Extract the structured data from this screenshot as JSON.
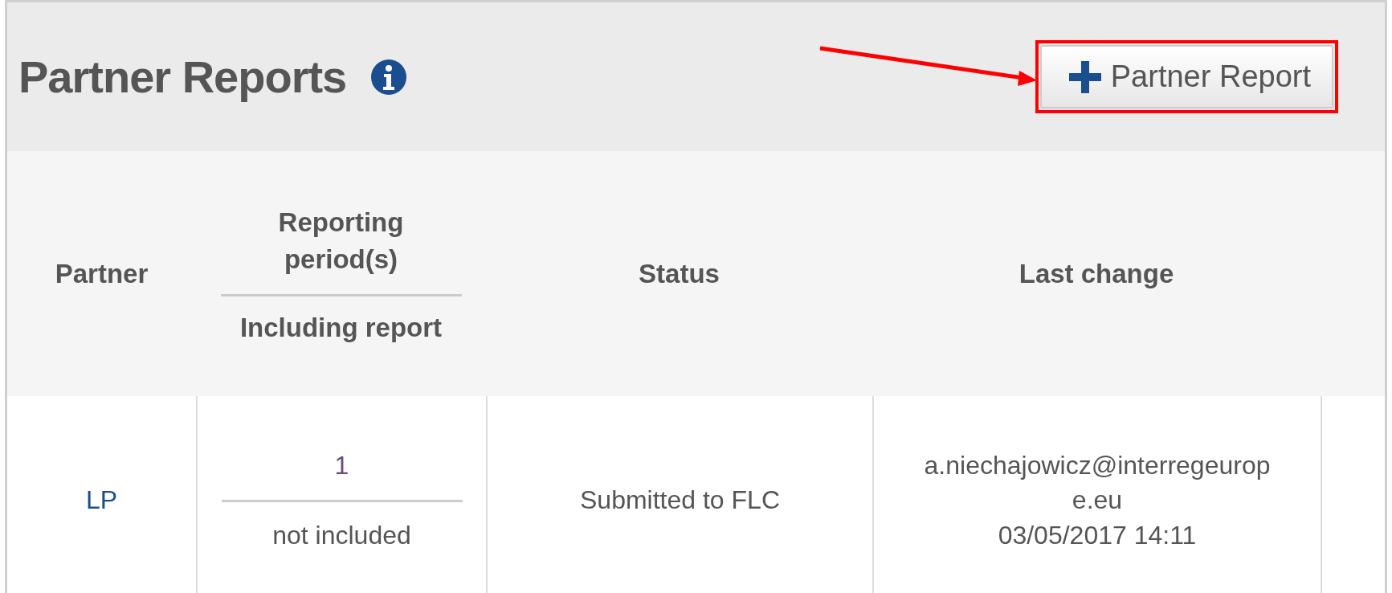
{
  "panel": {
    "title": "Partner Reports",
    "add_button": {
      "label": "Partner Report",
      "highlighted": true
    }
  },
  "table": {
    "columns": [
      {
        "kind": "single",
        "label": "Partner"
      },
      {
        "kind": "split",
        "label": "Reporting period(s)",
        "sublabel": "Including report"
      },
      {
        "kind": "single",
        "label": "Status"
      },
      {
        "kind": "single",
        "label": "Last change"
      },
      {
        "kind": "empty"
      }
    ],
    "rows": [
      {
        "partner": "LP",
        "period": "1",
        "report": "not included",
        "status": "Submitted to FLC",
        "changed_by": "a.niechajowicz@interregeurope.eu",
        "changed_at": "03/05/2017 14:11"
      }
    ]
  }
}
